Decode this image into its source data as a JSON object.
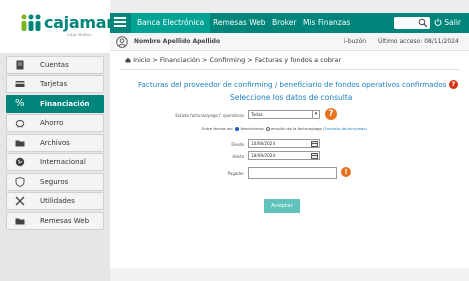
{
  "brand": {
    "name": "cajamar",
    "sub": "CAJA RURAL"
  },
  "nav": {
    "active": "Banca Electrónica",
    "items": [
      "Remesas Web",
      "Broker",
      "Mis Finanzas"
    ],
    "salir": "Salir"
  },
  "user": {
    "name": "Nombre Apellido Apellido",
    "ibuzon": "i-buzón",
    "last_access": "Último acceso: 08/11/2024"
  },
  "sidebar": {
    "items": [
      {
        "label": "Cuentas",
        "icon": "ledger-icon"
      },
      {
        "label": "Tarjetas",
        "icon": "card-icon"
      },
      {
        "label": "Financiación",
        "icon": "percent-icon",
        "active": true
      },
      {
        "label": "Ahorro",
        "icon": "piggy-bank-icon"
      },
      {
        "label": "Archivos",
        "icon": "folder-icon"
      },
      {
        "label": "Internacional",
        "icon": "globe-icon"
      },
      {
        "label": "Seguros",
        "icon": "shield-icon"
      },
      {
        "label": "Utilidades",
        "icon": "tools-icon"
      },
      {
        "label": "Remesas Web",
        "icon": "folder-icon"
      }
    ]
  },
  "breadcrumb": "Inicio > Financiación > Confirming > Facturas y fondos a cobrar",
  "page": {
    "title": "Facturas del proveedor de confirming / beneficiario de fondos operativos confirmados",
    "subtitle": "Seleccione los datos de consulta"
  },
  "form": {
    "estado_label": "Estado facturas/pago f. operativos",
    "estado_value": "Todas",
    "fechas_label": "Entre fechas de:",
    "opt1": "Vencimiento",
    "opt2": "emisión de la factura/pago",
    "opt2_link": "(Formato dd/mm/aaaa)",
    "desde_label": "Desde",
    "desde_value": "10/08/2024",
    "hasta_label": "Hasta",
    "hasta_value": "18/09/2024",
    "pagador_label": "Pagador",
    "pagador_value": "",
    "submit": "Aceptar"
  },
  "colors": {
    "brand": "#00857a",
    "link": "#1a7fbf",
    "button": "#5fc3bb"
  }
}
